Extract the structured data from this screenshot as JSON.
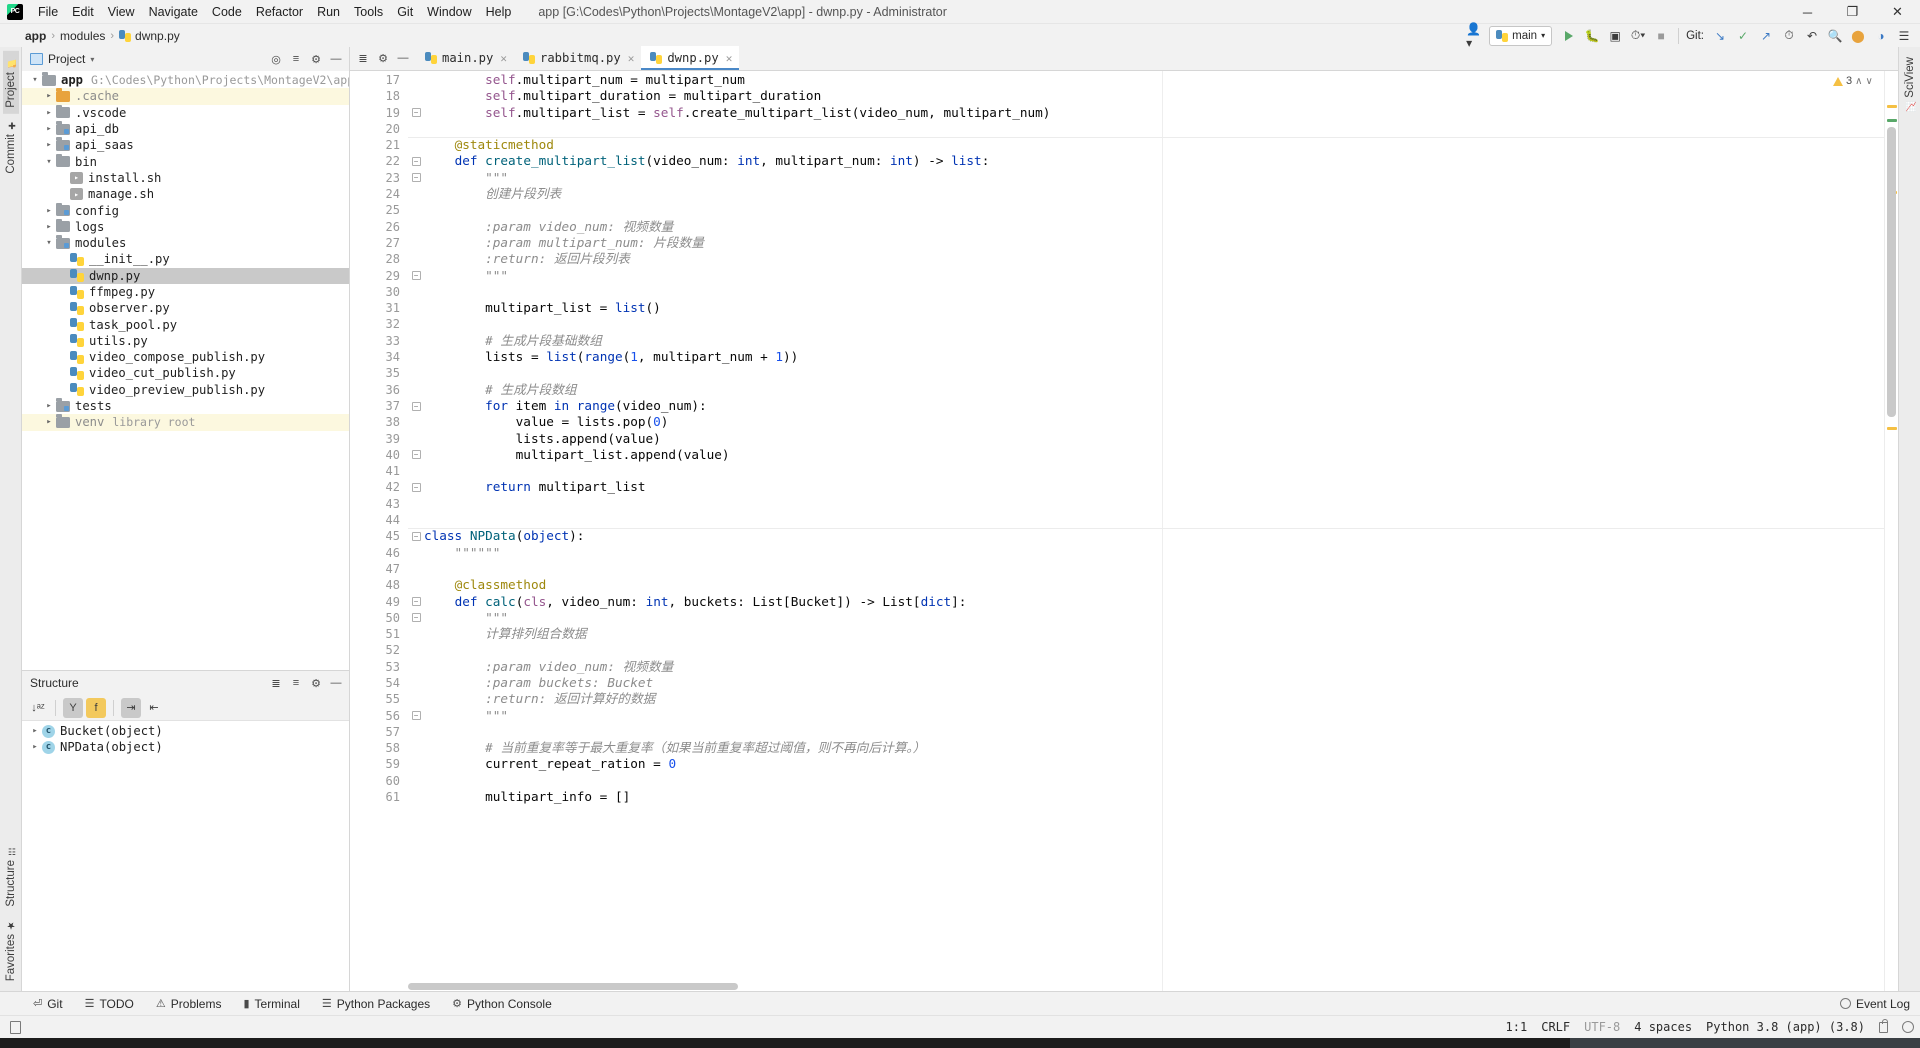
{
  "titlebar": {
    "app_icon": "pycharm-logo",
    "menus": [
      "File",
      "Edit",
      "View",
      "Navigate",
      "Code",
      "Refactor",
      "Run",
      "Tools",
      "Git",
      "Window",
      "Help"
    ],
    "project_title": "app [G:\\Codes\\Python\\Projects\\MontageV2\\app] - dwnp.py - Administrator",
    "window_controls": {
      "minimize": "─",
      "maximize": "❐",
      "close": "✕"
    }
  },
  "navbar": {
    "breadcrumb": [
      "app",
      "modules",
      "dwnp.py"
    ],
    "separator": "›",
    "run_config": "main",
    "git_label": "Git:",
    "avatar_icon": "user-avatar-icon",
    "run_icon": "run-icon",
    "debug_icon": "debug-icon",
    "coverage_icon": "coverage-icon",
    "profile_icon": "profile-icon",
    "stop_icon": "stop-icon",
    "update_icon": "git-update-icon",
    "commit_icon": "git-commit-icon",
    "push_icon": "git-push-icon",
    "history_icon": "git-history-icon",
    "rollback_icon": "git-rollback-icon",
    "search_icon": "search-everywhere-icon",
    "notification_icon": "notification-icon",
    "settings_icon": "settings-icon",
    "hamburger_icon": "hamburger-icon"
  },
  "left_strip": {
    "top_tabs": [
      {
        "label": "Project",
        "icon": "project-icon",
        "active": true
      },
      {
        "label": "Commit",
        "icon": "commit-icon",
        "active": false
      }
    ],
    "bottom_tabs": [
      {
        "label": "Structure",
        "icon": "structure-icon"
      },
      {
        "label": "Favorites",
        "icon": "star-icon"
      }
    ]
  },
  "right_strip": {
    "tabs": [
      {
        "label": "SciView",
        "icon": "sciview-icon"
      }
    ]
  },
  "project_panel": {
    "title": "Project",
    "dropdown_icon": "chevron-down-icon",
    "actions": [
      "select-opened-file-icon",
      "collapse-all-icon",
      "settings-icon",
      "hide-icon"
    ],
    "tree": [
      {
        "label": "app",
        "sub": "G:\\Codes\\Python\\Projects\\MontageV2\\app",
        "indent": 0,
        "arrow": "open",
        "icon": "folder",
        "bold": true
      },
      {
        "label": ".cache",
        "indent": 1,
        "arrow": "closed",
        "icon": "folder-orange",
        "highlight": true
      },
      {
        "label": ".vscode",
        "indent": 1,
        "arrow": "closed",
        "icon": "folder"
      },
      {
        "label": "api_db",
        "indent": 1,
        "arrow": "closed",
        "icon": "folder-src"
      },
      {
        "label": "api_saas",
        "indent": 1,
        "arrow": "closed",
        "icon": "folder-src"
      },
      {
        "label": "bin",
        "indent": 1,
        "arrow": "open",
        "icon": "folder"
      },
      {
        "label": "install.sh",
        "indent": 2,
        "arrow": "none",
        "icon": "sh-file"
      },
      {
        "label": "manage.sh",
        "indent": 2,
        "arrow": "none",
        "icon": "sh-file"
      },
      {
        "label": "config",
        "indent": 1,
        "arrow": "closed",
        "icon": "folder-src"
      },
      {
        "label": "logs",
        "indent": 1,
        "arrow": "closed",
        "icon": "folder"
      },
      {
        "label": "modules",
        "indent": 1,
        "arrow": "open",
        "icon": "folder-src"
      },
      {
        "label": "__init__.py",
        "indent": 2,
        "arrow": "none",
        "icon": "py-file"
      },
      {
        "label": "dwnp.py",
        "indent": 2,
        "arrow": "none",
        "icon": "py-file",
        "selected": true
      },
      {
        "label": "ffmpeg.py",
        "indent": 2,
        "arrow": "none",
        "icon": "py-file"
      },
      {
        "label": "observer.py",
        "indent": 2,
        "arrow": "none",
        "icon": "py-file"
      },
      {
        "label": "task_pool.py",
        "indent": 2,
        "arrow": "none",
        "icon": "py-file"
      },
      {
        "label": "utils.py",
        "indent": 2,
        "arrow": "none",
        "icon": "py-file"
      },
      {
        "label": "video_compose_publish.py",
        "indent": 2,
        "arrow": "none",
        "icon": "py-file"
      },
      {
        "label": "video_cut_publish.py",
        "indent": 2,
        "arrow": "none",
        "icon": "py-file"
      },
      {
        "label": "video_preview_publish.py",
        "indent": 2,
        "arrow": "none",
        "icon": "py-file"
      },
      {
        "label": "tests",
        "indent": 1,
        "arrow": "closed",
        "icon": "folder-src"
      },
      {
        "label": "venv",
        "sub": "library root",
        "indent": 1,
        "arrow": "closed",
        "icon": "folder",
        "highlight": true
      }
    ]
  },
  "structure_panel": {
    "title": "Structure",
    "actions": [
      "expand-all-icon",
      "collapse-all-icon",
      "settings-icon",
      "hide-icon"
    ],
    "toolbar": [
      {
        "name": "sort-alphabetically-icon",
        "glyph": "↓ᵃᶻ",
        "active": false
      },
      {
        "name": "filter-inherited-icon",
        "glyph": "Y",
        "active": true
      },
      {
        "name": "show-fields-icon",
        "glyph": "f",
        "active": true,
        "yellow": true
      },
      {
        "name": "expand-all-icon",
        "glyph": "⇥",
        "active": true
      },
      {
        "name": "collapse-all-icon",
        "glyph": "⇤",
        "active": false
      }
    ],
    "items": [
      {
        "label": "Bucket(object)",
        "icon": "class-icon",
        "arrow": "closed"
      },
      {
        "label": "NPData(object)",
        "icon": "class-icon",
        "arrow": "closed"
      }
    ]
  },
  "editor": {
    "tab_tools": [
      "collapse-icon",
      "settings-icon",
      "hide-icon"
    ],
    "tabs": [
      {
        "label": "main.py",
        "icon": "py-file",
        "active": false
      },
      {
        "label": "rabbitmq.py",
        "icon": "py-file",
        "active": false
      },
      {
        "label": "dwnp.py",
        "icon": "py-file",
        "active": true
      }
    ],
    "inspection": {
      "warnings": "3",
      "icon": "warning-triangle-icon",
      "up": "∧",
      "down": "∨"
    },
    "first_line": 17,
    "lines": [
      {
        "n": 17,
        "fold": false,
        "tokens": [
          {
            "t": "        ",
            "c": ""
          },
          {
            "t": "self",
            "c": "self"
          },
          {
            "t": ".multipart_num = multipart_num",
            "c": ""
          }
        ]
      },
      {
        "n": 18,
        "fold": false,
        "tokens": [
          {
            "t": "        ",
            "c": ""
          },
          {
            "t": "self",
            "c": "self"
          },
          {
            "t": ".multipart_duration = multipart_duration",
            "c": ""
          }
        ]
      },
      {
        "n": 19,
        "fold": true,
        "tokens": [
          {
            "t": "        ",
            "c": ""
          },
          {
            "t": "self",
            "c": "self"
          },
          {
            "t": ".multipart_list = ",
            "c": ""
          },
          {
            "t": "self",
            "c": "self"
          },
          {
            "t": ".create_multipart_list(video_num, multipart_num)",
            "c": ""
          }
        ]
      },
      {
        "n": 20,
        "fold": false,
        "tokens": []
      },
      {
        "n": 21,
        "fold": false,
        "tokens": [
          {
            "t": "    ",
            "c": ""
          },
          {
            "t": "@staticmethod",
            "c": "dec"
          }
        ]
      },
      {
        "n": 22,
        "fold": true,
        "tokens": [
          {
            "t": "    ",
            "c": ""
          },
          {
            "t": "def ",
            "c": "kw"
          },
          {
            "t": "create_multipart_list",
            "c": "fn"
          },
          {
            "t": "(video_num: ",
            "c": ""
          },
          {
            "t": "int",
            "c": "kw"
          },
          {
            "t": ", multipart_num: ",
            "c": ""
          },
          {
            "t": "int",
            "c": "kw"
          },
          {
            "t": ") -> ",
            "c": ""
          },
          {
            "t": "list",
            "c": "kw"
          },
          {
            "t": ":",
            "c": ""
          }
        ]
      },
      {
        "n": 23,
        "fold": true,
        "tokens": [
          {
            "t": "        \"\"\"",
            "c": "doc"
          }
        ]
      },
      {
        "n": 24,
        "fold": false,
        "tokens": [
          {
            "t": "        创建片段列表",
            "c": "doc"
          }
        ]
      },
      {
        "n": 25,
        "fold": false,
        "tokens": []
      },
      {
        "n": 26,
        "fold": false,
        "tokens": [
          {
            "t": "        :param video_num: 视频数量",
            "c": "doc"
          }
        ]
      },
      {
        "n": 27,
        "fold": false,
        "tokens": [
          {
            "t": "        :param multipart_num: 片段数量",
            "c": "doc"
          }
        ]
      },
      {
        "n": 28,
        "fold": false,
        "tokens": [
          {
            "t": "        :return: 返回片段列表",
            "c": "doc"
          }
        ]
      },
      {
        "n": 29,
        "fold": true,
        "tokens": [
          {
            "t": "        \"\"\"",
            "c": "doc"
          }
        ]
      },
      {
        "n": 30,
        "fold": false,
        "tokens": []
      },
      {
        "n": 31,
        "fold": false,
        "tokens": [
          {
            "t": "        multipart_list = ",
            "c": ""
          },
          {
            "t": "list",
            "c": "kw"
          },
          {
            "t": "()",
            "c": ""
          }
        ]
      },
      {
        "n": 32,
        "fold": false,
        "tokens": []
      },
      {
        "n": 33,
        "fold": false,
        "tokens": [
          {
            "t": "        # 生成片段基础数组",
            "c": "com"
          }
        ]
      },
      {
        "n": 34,
        "fold": false,
        "tokens": [
          {
            "t": "        lists = ",
            "c": ""
          },
          {
            "t": "list",
            "c": "kw"
          },
          {
            "t": "(",
            "c": ""
          },
          {
            "t": "range",
            "c": "kw"
          },
          {
            "t": "(",
            "c": ""
          },
          {
            "t": "1",
            "c": "num"
          },
          {
            "t": ", multipart_num + ",
            "c": ""
          },
          {
            "t": "1",
            "c": "num"
          },
          {
            "t": "))",
            "c": ""
          }
        ]
      },
      {
        "n": 35,
        "fold": false,
        "tokens": []
      },
      {
        "n": 36,
        "fold": false,
        "tokens": [
          {
            "t": "        # 生成片段数组",
            "c": "com"
          }
        ]
      },
      {
        "n": 37,
        "fold": true,
        "tokens": [
          {
            "t": "        ",
            "c": ""
          },
          {
            "t": "for",
            "c": "kw"
          },
          {
            "t": " item ",
            "c": ""
          },
          {
            "t": "in",
            "c": "kw"
          },
          {
            "t": " ",
            "c": ""
          },
          {
            "t": "range",
            "c": "kw"
          },
          {
            "t": "(video_num):",
            "c": ""
          }
        ]
      },
      {
        "n": 38,
        "fold": false,
        "tokens": [
          {
            "t": "            value = lists.pop(",
            "c": ""
          },
          {
            "t": "0",
            "c": "num"
          },
          {
            "t": ")",
            "c": ""
          }
        ]
      },
      {
        "n": 39,
        "fold": false,
        "tokens": [
          {
            "t": "            lists.append(value)",
            "c": ""
          }
        ]
      },
      {
        "n": 40,
        "fold": true,
        "tokens": [
          {
            "t": "            multipart_list.append(value)",
            "c": ""
          }
        ]
      },
      {
        "n": 41,
        "fold": false,
        "tokens": []
      },
      {
        "n": 42,
        "fold": true,
        "tokens": [
          {
            "t": "        ",
            "c": ""
          },
          {
            "t": "return",
            "c": "kw"
          },
          {
            "t": " multipart_list",
            "c": ""
          }
        ]
      },
      {
        "n": 43,
        "fold": false,
        "tokens": []
      },
      {
        "n": 44,
        "fold": false,
        "tokens": []
      },
      {
        "n": 45,
        "fold": true,
        "tokens": [
          {
            "t": "class ",
            "c": "kw"
          },
          {
            "t": "NPData",
            "c": "fn"
          },
          {
            "t": "(",
            "c": ""
          },
          {
            "t": "object",
            "c": "kw"
          },
          {
            "t": "):",
            "c": ""
          }
        ]
      },
      {
        "n": 46,
        "fold": false,
        "tokens": [
          {
            "t": "    \"\"\"\"\"\"",
            "c": "doc"
          }
        ]
      },
      {
        "n": 47,
        "fold": false,
        "tokens": []
      },
      {
        "n": 48,
        "fold": false,
        "tokens": [
          {
            "t": "    ",
            "c": ""
          },
          {
            "t": "@classmethod",
            "c": "dec"
          }
        ]
      },
      {
        "n": 49,
        "fold": true,
        "tokens": [
          {
            "t": "    ",
            "c": ""
          },
          {
            "t": "def ",
            "c": "kw"
          },
          {
            "t": "calc",
            "c": "fn"
          },
          {
            "t": "(",
            "c": ""
          },
          {
            "t": "cls",
            "c": "self"
          },
          {
            "t": ", video_num: ",
            "c": ""
          },
          {
            "t": "int",
            "c": "kw"
          },
          {
            "t": ", buckets: List[Bucket]) -> List[",
            "c": ""
          },
          {
            "t": "dict",
            "c": "kw"
          },
          {
            "t": "]:",
            "c": ""
          }
        ]
      },
      {
        "n": 50,
        "fold": true,
        "tokens": [
          {
            "t": "        \"\"\"",
            "c": "doc"
          }
        ]
      },
      {
        "n": 51,
        "fold": false,
        "tokens": [
          {
            "t": "        计算排列组合数据",
            "c": "doc"
          }
        ]
      },
      {
        "n": 52,
        "fold": false,
        "tokens": []
      },
      {
        "n": 53,
        "fold": false,
        "tokens": [
          {
            "t": "        :param video_num: 视频数量",
            "c": "doc"
          }
        ]
      },
      {
        "n": 54,
        "fold": false,
        "tokens": [
          {
            "t": "        :param buckets: Bucket",
            "c": "doc"
          }
        ]
      },
      {
        "n": 55,
        "fold": false,
        "tokens": [
          {
            "t": "        :return: 返回计算好的数据",
            "c": "doc"
          }
        ]
      },
      {
        "n": 56,
        "fold": true,
        "tokens": [
          {
            "t": "        \"\"\"",
            "c": "doc"
          }
        ]
      },
      {
        "n": 57,
        "fold": false,
        "tokens": []
      },
      {
        "n": 58,
        "fold": false,
        "tokens": [
          {
            "t": "        # 当前重复率等于最大重复率（如果当前重复率超过阈值，则不再向后计算。）",
            "c": "com"
          }
        ]
      },
      {
        "n": 59,
        "fold": false,
        "tokens": [
          {
            "t": "        current_repeat_ration = ",
            "c": ""
          },
          {
            "t": "0",
            "c": "num"
          }
        ]
      },
      {
        "n": 60,
        "fold": false,
        "tokens": []
      },
      {
        "n": 61,
        "fold": false,
        "tokens": [
          {
            "t": "        multipart_info = []",
            "c": ""
          }
        ]
      }
    ]
  },
  "toolwindow_bar": {
    "items": [
      {
        "label": "Git",
        "icon": "git-branch-icon"
      },
      {
        "label": "TODO",
        "icon": "todo-list-icon"
      },
      {
        "label": "Problems",
        "icon": "problems-icon"
      },
      {
        "label": "Terminal",
        "icon": "terminal-icon"
      },
      {
        "label": "Python Packages",
        "icon": "packages-icon"
      },
      {
        "label": "Python Console",
        "icon": "python-console-icon"
      }
    ],
    "event_log": {
      "label": "Event Log",
      "icon": "event-log-icon"
    }
  },
  "statusbar": {
    "left_icon": "show-tool-windows-icon",
    "position": "1:1",
    "line_separator": "CRLF",
    "encoding": "UTF-8",
    "indent": "4 spaces",
    "interpreter": "Python 3.8 (app)",
    "branch": "(3.8)",
    "lock_icon": "read-only-lock-icon",
    "gear_icon": "ide-settings-icon"
  },
  "colors": {
    "accent": "#4a88c7",
    "keyword": "#0033b3",
    "number": "#1750eb",
    "decorator": "#9e880d",
    "comment": "#8c8c8c",
    "function": "#00627a",
    "self": "#94558d",
    "run_green": "#59a869",
    "warning": "#f5c043",
    "selection": "#c9c9c9",
    "highlight": "#fcf8df"
  }
}
